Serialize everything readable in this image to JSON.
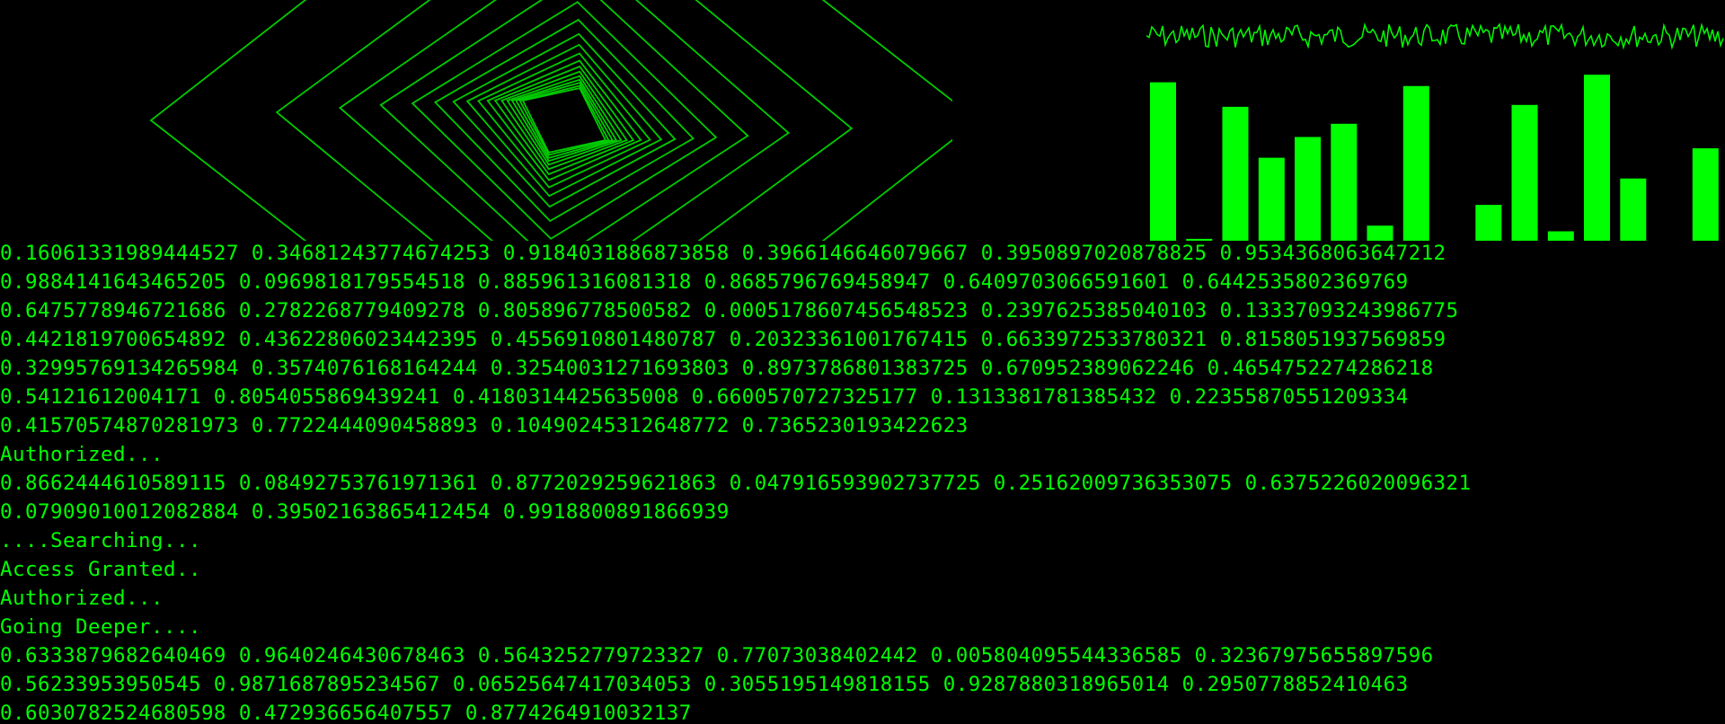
{
  "theme": {
    "background": "#000000",
    "foreground": "#00ff00",
    "graphic_stroke": "#00cc00",
    "bar_fill": "#00ff00"
  },
  "bar_chart": {
    "values": [
      0.84,
      0.01,
      0.71,
      0.44,
      0.55,
      0.62,
      0.08,
      0.82,
      0.0,
      0.19,
      0.72,
      0.05,
      0.88,
      0.33,
      0.0,
      0.49
    ]
  },
  "terminal": {
    "lines": [
      "0.16061331989444527 0.34681243774674253 0.9184031886873858 0.3966146646079667 0.3950897020878825 0.9534368063647212",
      "0.9884141643465205 0.0969818179554518 0.885961316081318 0.8685796769458947 0.6409703066591601 0.6442535802369769",
      "0.6475778946721686 0.2782268779409278 0.805896778500582 0.0005178607456548523 0.2397625385040103 0.13337093243986775",
      "0.4421819700654892 0.43622806023442395 0.4556910801480787 0.20323361001767415 0.6633972533780321 0.8158051937569859",
      "0.32995769134265984 0.3574076168164244 0.32540031271693803 0.8973786801383725 0.670952389062246 0.4654752274286218",
      "0.54121612004171 0.8054055869439241 0.4180314425635008 0.6600570727325177 0.1313381781385432 0.22355870551209334",
      "0.41570574870281973 0.7722444090458893 0.10490245312648772 0.7365230193422623",
      "Authorized...",
      "0.8662444610589115 0.08492753761971361 0.8772029259621863 0.047916593902737725 0.25162009736353075 0.6375226020096321",
      "0.07909010012082884 0.39502163865412454 0.9918800891866939",
      "....Searching...",
      "Access Granted..",
      "Authorized...",
      "Going Deeper....",
      "0.6333879682640469 0.9640246430678463 0.5643252779723327 0.77073038402442 0.005804095544336585 0.32367975655897596",
      "0.56233953950545 0.9871687895234567 0.06525647417034053 0.3055195149818155 0.9287880318965014 0.2950778852410463",
      "0.6030782524680598 0.472936656407557 0.8774264910032137"
    ]
  }
}
